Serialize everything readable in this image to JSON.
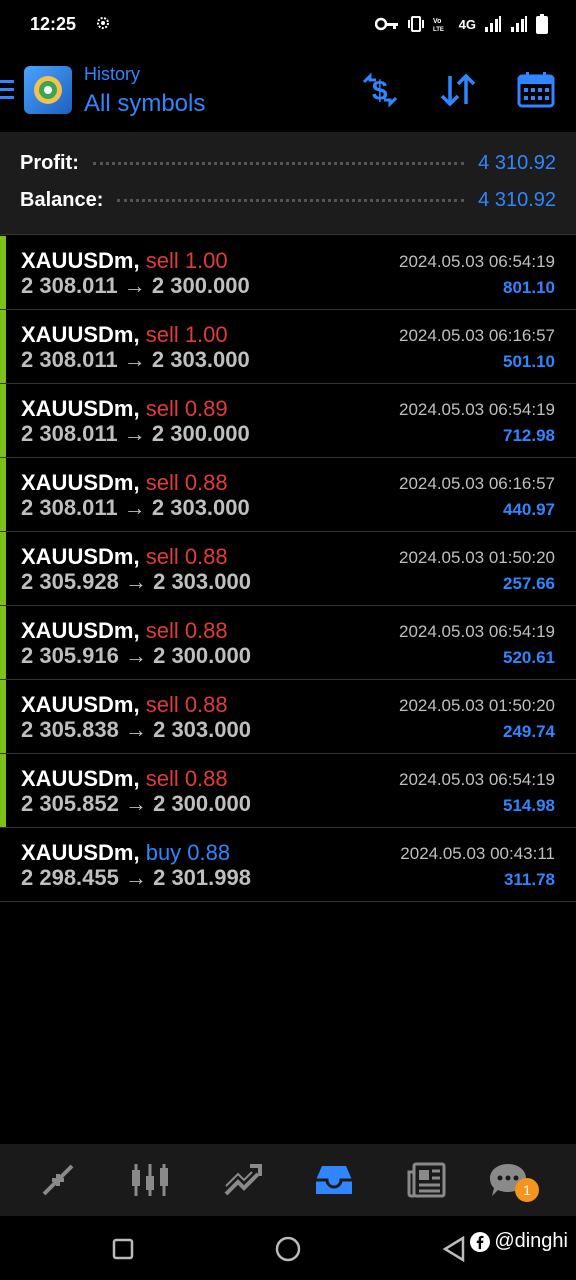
{
  "status_bar": {
    "time": "12:25",
    "network": "4G",
    "icons": [
      "gear-icon",
      "key-icon",
      "vibrate-icon",
      "volte-icon",
      "signal-icon",
      "signal-icon",
      "battery-icon"
    ]
  },
  "header": {
    "subtitle": "History",
    "title": "All symbols",
    "actions": [
      "dollar-exchange-icon",
      "sort-icon",
      "calendar-icon"
    ]
  },
  "summary": {
    "profit_label": "Profit:",
    "profit_value": "4 310.92",
    "balance_label": "Balance:",
    "balance_value": "4 310.92"
  },
  "colors": {
    "accent": "#2f86ff",
    "sell": "#e23b3b",
    "buy": "#2f86ff",
    "bar": "#7bc11a"
  },
  "trades": [
    {
      "symbol": "XAUUSDm,",
      "type": "sell 1.00",
      "side": "sell",
      "prices": "2 308.011 → 2 300.000",
      "datetime": "2024.05.03 06:54:19",
      "profit": "801.10",
      "bar": true
    },
    {
      "symbol": "XAUUSDm,",
      "type": "sell 1.00",
      "side": "sell",
      "prices": "2 308.011 → 2 303.000",
      "datetime": "2024.05.03 06:16:57",
      "profit": "501.10",
      "bar": true
    },
    {
      "symbol": "XAUUSDm,",
      "type": "sell 0.89",
      "side": "sell",
      "prices": "2 308.011 → 2 300.000",
      "datetime": "2024.05.03 06:54:19",
      "profit": "712.98",
      "bar": true
    },
    {
      "symbol": "XAUUSDm,",
      "type": "sell 0.88",
      "side": "sell",
      "prices": "2 308.011 → 2 303.000",
      "datetime": "2024.05.03 06:16:57",
      "profit": "440.97",
      "bar": true
    },
    {
      "symbol": "XAUUSDm,",
      "type": "sell 0.88",
      "side": "sell",
      "prices": "2 305.928 → 2 303.000",
      "datetime": "2024.05.03 01:50:20",
      "profit": "257.66",
      "bar": true
    },
    {
      "symbol": "XAUUSDm,",
      "type": "sell 0.88",
      "side": "sell",
      "prices": "2 305.916 → 2 300.000",
      "datetime": "2024.05.03 06:54:19",
      "profit": "520.61",
      "bar": true
    },
    {
      "symbol": "XAUUSDm,",
      "type": "sell 0.88",
      "side": "sell",
      "prices": "2 305.838 → 2 303.000",
      "datetime": "2024.05.03 01:50:20",
      "profit": "249.74",
      "bar": true
    },
    {
      "symbol": "XAUUSDm,",
      "type": "sell 0.88",
      "side": "sell",
      "prices": "2 305.852 → 2 300.000",
      "datetime": "2024.05.03 06:54:19",
      "profit": "514.98",
      "bar": true
    },
    {
      "symbol": "XAUUSDm,",
      "type": "buy 0.88",
      "side": "buy",
      "prices": "2 298.455 → 2 301.998",
      "datetime": "2024.05.03 00:43:11",
      "profit": "311.78",
      "bar": false
    }
  ],
  "bottom_nav": {
    "items": [
      "quotes-icon",
      "chart-icon",
      "trade-icon",
      "history-icon",
      "news-icon",
      "chat-icon"
    ],
    "active": "history-icon",
    "chat_badge": "1"
  },
  "watermark": "@dinghi"
}
